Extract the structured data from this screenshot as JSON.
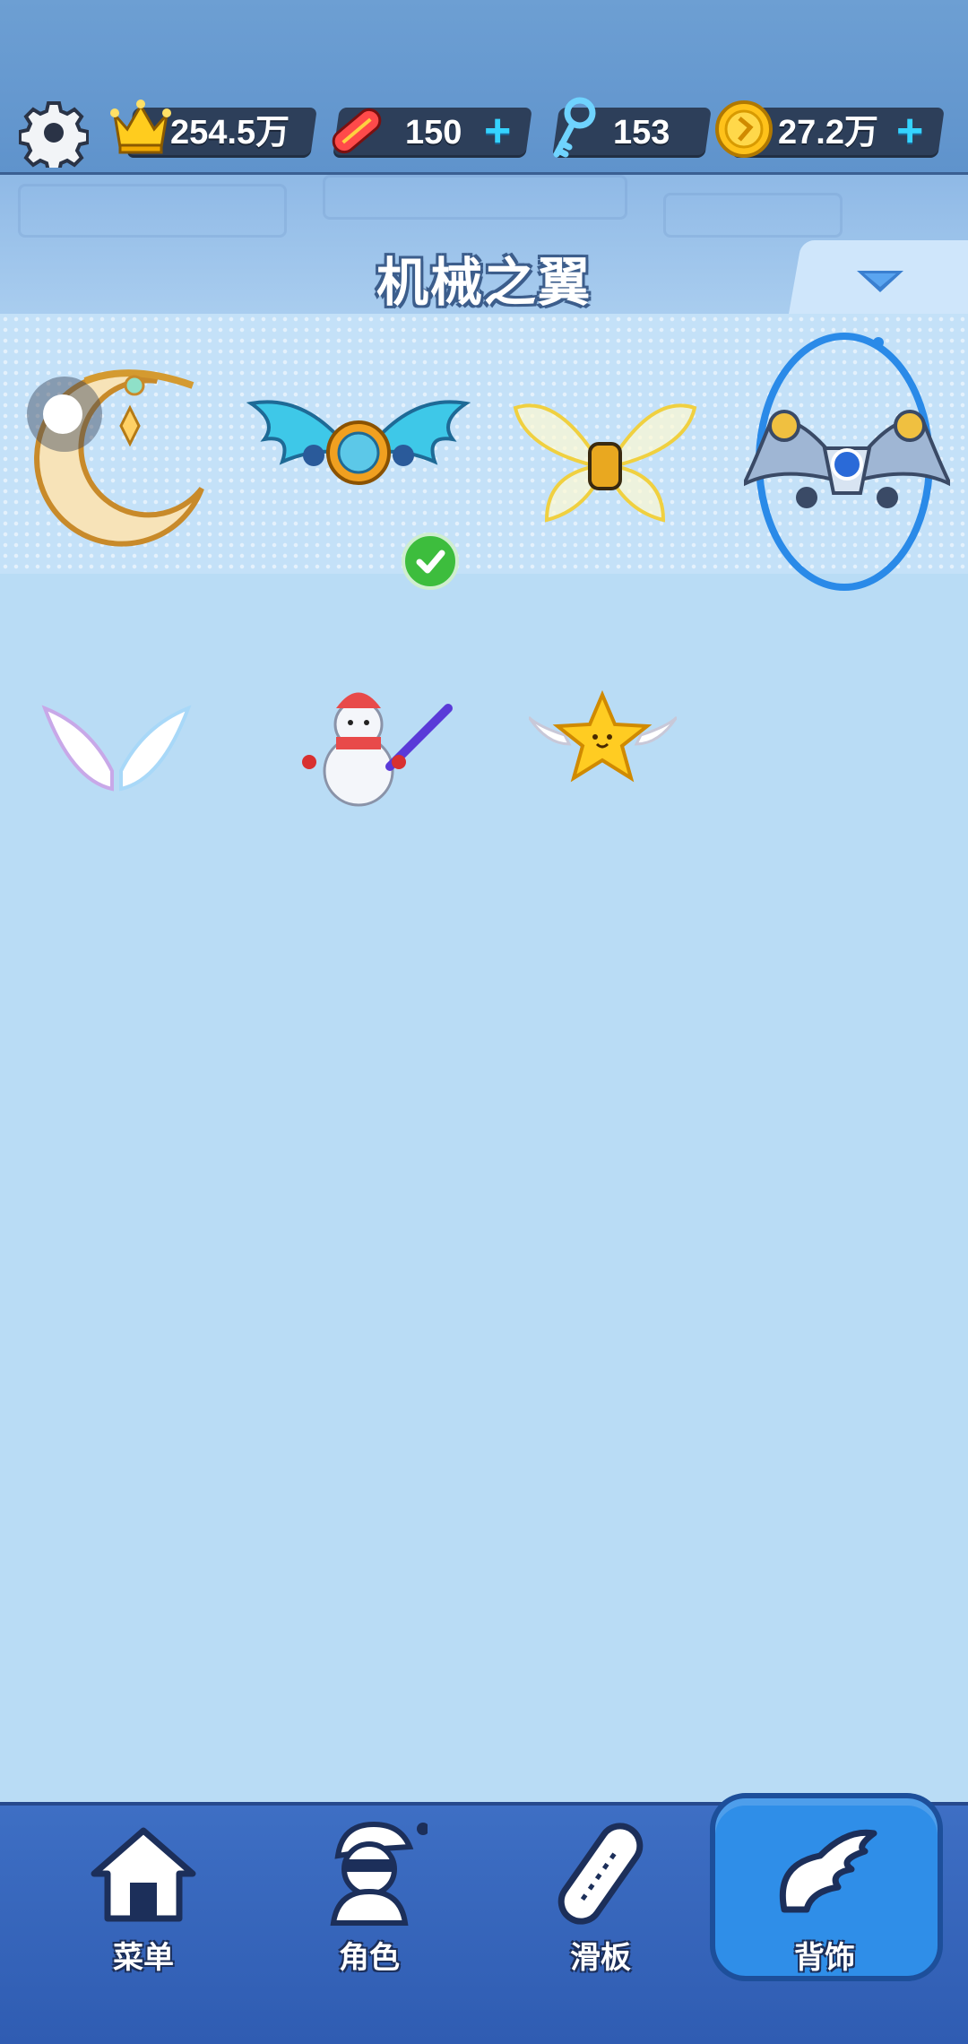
{
  "resources": {
    "crown": {
      "icon": "crown-icon",
      "value": "254.5万"
    },
    "skateboard": {
      "icon": "skateboard-icon",
      "value": "150"
    },
    "key": {
      "icon": "key-icon",
      "value": "153"
    },
    "coin": {
      "icon": "coin-icon",
      "value": "27.2万"
    },
    "plus_label": "+"
  },
  "header": {
    "title": "机械之翼"
  },
  "items": [
    {
      "icon": "crescent-moon-backpiece-icon"
    },
    {
      "icon": "cyan-gear-wings-icon",
      "equipped": true
    },
    {
      "icon": "golden-butterfly-wings-icon"
    },
    {
      "icon": "mechanical-wings-icon",
      "selected": true
    },
    {
      "icon": "angel-wings-icon"
    },
    {
      "icon": "snowman-icon"
    },
    {
      "icon": "winged-star-icon"
    }
  ],
  "nav": {
    "menu": "菜单",
    "character": "角色",
    "skateboard": "滑板",
    "backpiece": "背饰",
    "active": "backpiece"
  },
  "colors": {
    "accent": "#2f8ee8",
    "background": "#b9dcf5",
    "check": "#3dbd3d"
  }
}
